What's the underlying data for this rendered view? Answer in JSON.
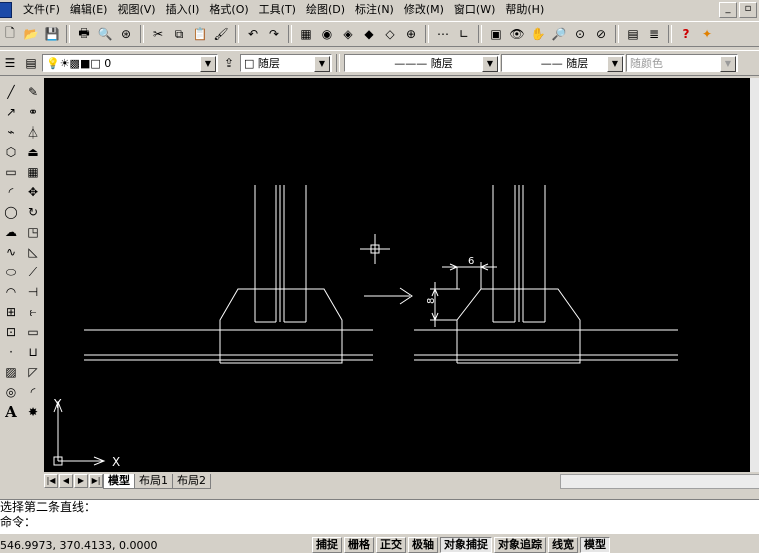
{
  "menubar": {
    "items": [
      "文件(F)",
      "编辑(E)",
      "视图(V)",
      "插入(I)",
      "格式(O)",
      "工具(T)",
      "绘图(D)",
      "标注(N)",
      "修改(M)",
      "窗口(W)",
      "帮助(H)"
    ],
    "window_buttons": [
      "_",
      "▫"
    ]
  },
  "toolbar2": {
    "layer_value": "0",
    "color_value": "□ 随层",
    "linetype_value": "——— 随层",
    "lineweight_value": "—— 随层",
    "plotstyle_value": "随颜色"
  },
  "drawing": {
    "dim_width": "6",
    "dim_height": "8",
    "ucs_x": "X",
    "ucs_y": "Y"
  },
  "tabs": [
    "模型",
    "布局1",
    "布局2"
  ],
  "command": {
    "history": "选择第二条直线：",
    "prompt": "命令："
  },
  "status": {
    "coords": "546.9973, 370.4133, 0.0000",
    "buttons": [
      {
        "label": "捕捉",
        "on": false
      },
      {
        "label": "栅格",
        "on": false
      },
      {
        "label": "正交",
        "on": false
      },
      {
        "label": "极轴",
        "on": false
      },
      {
        "label": "对象捕捉",
        "on": true
      },
      {
        "label": "对象追踪",
        "on": false
      },
      {
        "label": "线宽",
        "on": false
      },
      {
        "label": "模型",
        "on": true
      }
    ]
  },
  "colors": {
    "canvas": "#000000",
    "drawing_lines": "#ffffff",
    "chrome": "#d4d0c8"
  }
}
